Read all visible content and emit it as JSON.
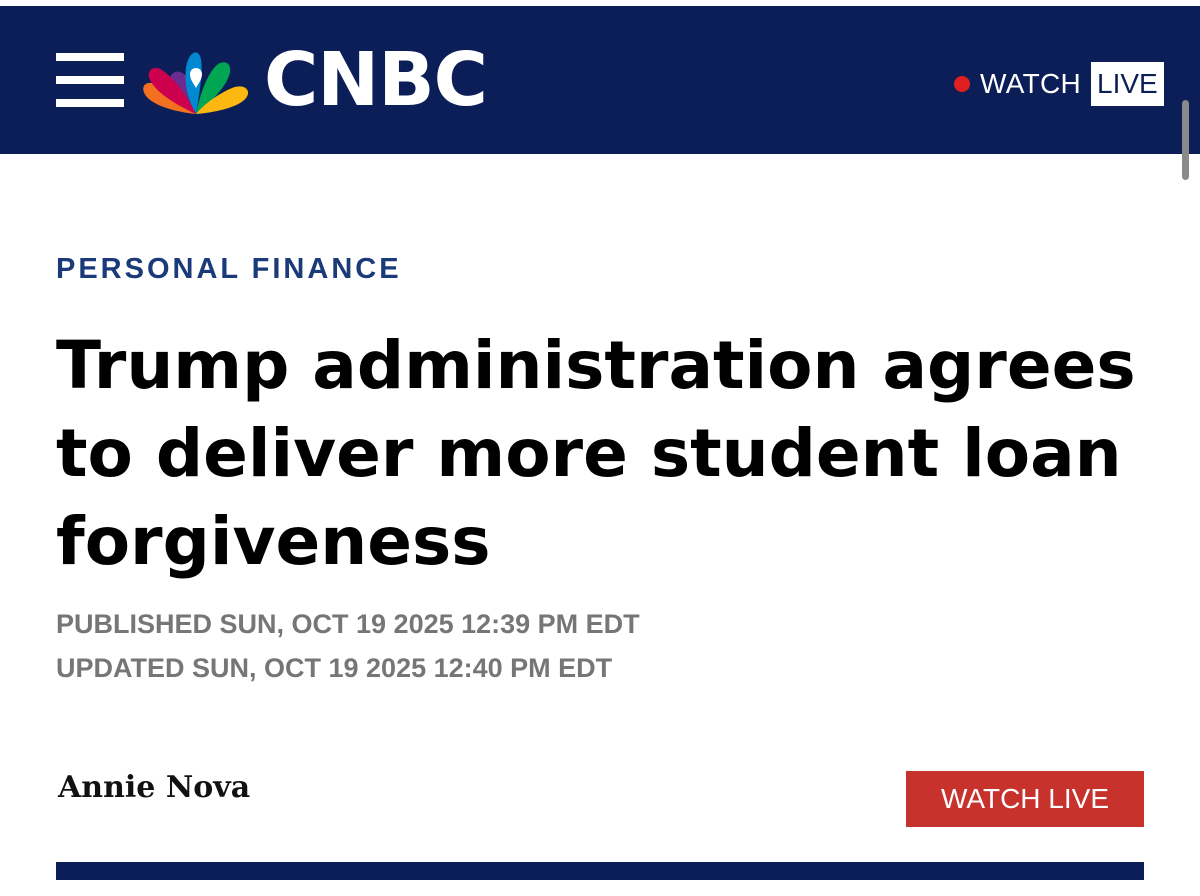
{
  "header": {
    "logo_text": "CNBC",
    "watch_label": "WATCH",
    "live_label": "LIVE",
    "icons": [
      "menu-icon",
      "peacock-logo-icon",
      "live-dot-icon"
    ]
  },
  "article": {
    "section": "PERSONAL FINANCE",
    "headline": "Trump administration agrees to deliver more student loan forgiveness",
    "published": "PUBLISHED SUN, OCT 19 2025 12:39 PM EDT",
    "updated": "UPDATED SUN, OCT 19 2025 12:40 PM EDT",
    "author": "Annie Nova"
  },
  "watch_live_button": {
    "label": "WATCH LIVE"
  },
  "colors": {
    "header_bg": "#0c1e57",
    "section_label": "#1b3a7a",
    "live_dot": "#e02020",
    "watch_live_button_bg": "#c7322d",
    "timestamp": "#767676"
  }
}
